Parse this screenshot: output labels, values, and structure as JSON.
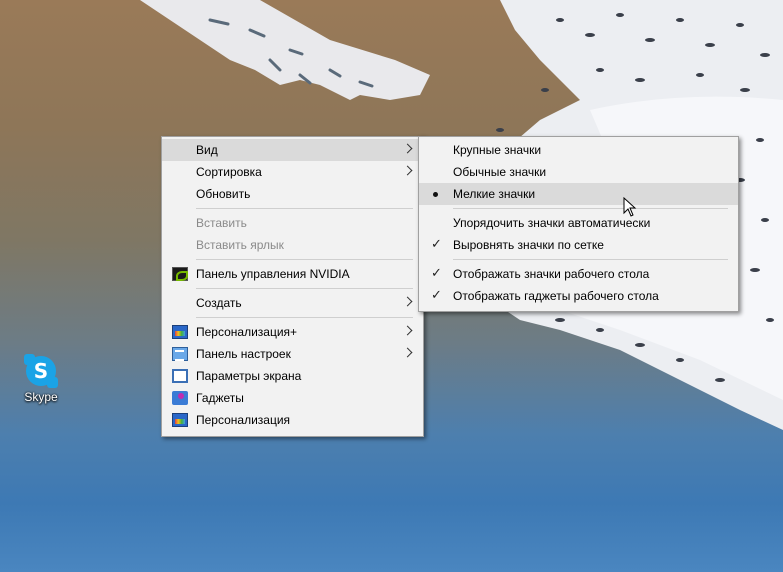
{
  "desktop": {
    "icons": [
      {
        "label": "Skype",
        "icon": "skype-icon"
      }
    ]
  },
  "context_menu": {
    "items": [
      {
        "label": "Вид",
        "has_submenu": true,
        "state": "hover"
      },
      {
        "label": "Сортировка",
        "has_submenu": true
      },
      {
        "label": "Обновить"
      },
      {
        "label": "Вставить",
        "disabled": true
      },
      {
        "label": "Вставить ярлык",
        "disabled": true
      },
      {
        "label": "Панель управления NVIDIA",
        "icon": "nvidia-icon"
      },
      {
        "label": "Создать",
        "has_submenu": true
      },
      {
        "label": "Персонализация+",
        "icon": "personalization-icon",
        "has_submenu": true
      },
      {
        "label": "Панель настроек",
        "icon": "control-panel-icon",
        "has_submenu": true
      },
      {
        "label": "Параметры экрана",
        "icon": "display-settings-icon"
      },
      {
        "label": "Гаджеты",
        "icon": "gadgets-icon"
      },
      {
        "label": "Персонализация",
        "icon": "personalization-icon"
      }
    ]
  },
  "view_submenu": {
    "items": [
      {
        "label": "Крупные значки"
      },
      {
        "label": "Обычные значки"
      },
      {
        "label": "Мелкие значки",
        "selected": true,
        "state": "hover"
      },
      {
        "label": "Упорядочить значки автоматически"
      },
      {
        "label": "Выровнять значки по сетке",
        "checked": true
      },
      {
        "label": "Отображать значки рабочего стола",
        "checked": true
      },
      {
        "label": "Отображать гаджеты  рабочего стола",
        "checked": true
      }
    ]
  },
  "colors": {
    "menu_background": "#f2f2f2",
    "menu_hover": "#dadada",
    "disabled_text": "#8a8a8a",
    "skype_blue": "#1aa3e6",
    "nvidia_green": "#76b900"
  }
}
